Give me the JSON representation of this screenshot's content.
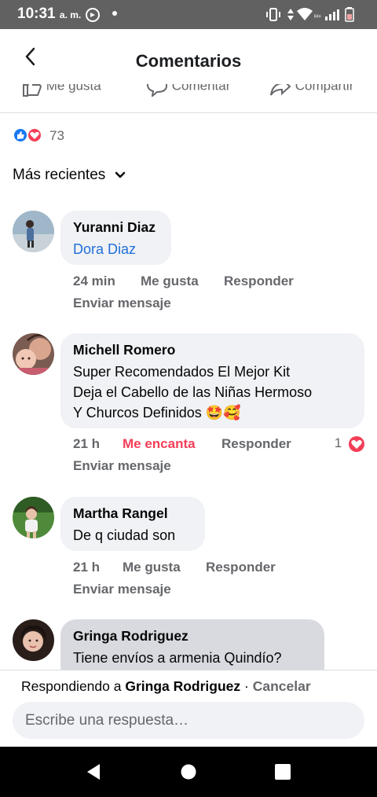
{
  "status_bar": {
    "time": "10:31",
    "ampm": "a. m.",
    "icons": [
      "refresh-circle-icon",
      "dot-icon",
      "vibrate-icon",
      "data-arrows-icon",
      "wifi-icon",
      "signal-icon",
      "battery-icon"
    ]
  },
  "header": {
    "title": "Comentarios",
    "back_icon": "chevron-left-icon"
  },
  "post_actions": {
    "like": "Me gusta",
    "comment": "Comentar",
    "share": "Compartir"
  },
  "reactions": {
    "count": "73",
    "icons": [
      "like-icon",
      "love-icon"
    ]
  },
  "sort": {
    "label": "Más recientes"
  },
  "comments": [
    {
      "author": "Yuranni Diaz",
      "text": "Dora Diaz",
      "is_mention": true,
      "time": "24 min",
      "reaction_action": "Me gusta",
      "reply": "Responder",
      "send": "Enviar mensaje",
      "react_count": ""
    },
    {
      "author": "Michell Romero",
      "text_lines": [
        "Super Recomendados El Mejor Kit",
        "Deja el Cabello de las Niñas Hermoso",
        "Y Churcos Definidos 🤩🥰"
      ],
      "time": "21 h",
      "reaction_action": "Me encanta",
      "reply": "Responder",
      "send": "Enviar mensaje",
      "react_count": "1"
    },
    {
      "author": "Martha Rangel",
      "text": "De q ciudad son",
      "time": "21 h",
      "reaction_action": "Me gusta",
      "reply": "Responder",
      "send": "Enviar mensaje",
      "react_count": ""
    },
    {
      "author": "Gringa Rodriguez",
      "text": "Tiene envíos a armenia Quindío?"
    }
  ],
  "reply_bar": {
    "prefix": "Respondiendo a",
    "target": "Gringa Rodriguez",
    "separator": " · ",
    "cancel": "Cancelar",
    "placeholder": "Escribe una respuesta…"
  },
  "nav_bar": {
    "icons": [
      "back-triangle-icon",
      "home-circle-icon",
      "recents-square-icon"
    ]
  },
  "colors": {
    "status_bar": "#616161",
    "bubble": "#f0f2f5",
    "bubble_selected": "#d8dadf",
    "mention": "#216fdb",
    "love": "#f33e58",
    "like": "#1877f2",
    "secondary_text": "#65676b"
  }
}
